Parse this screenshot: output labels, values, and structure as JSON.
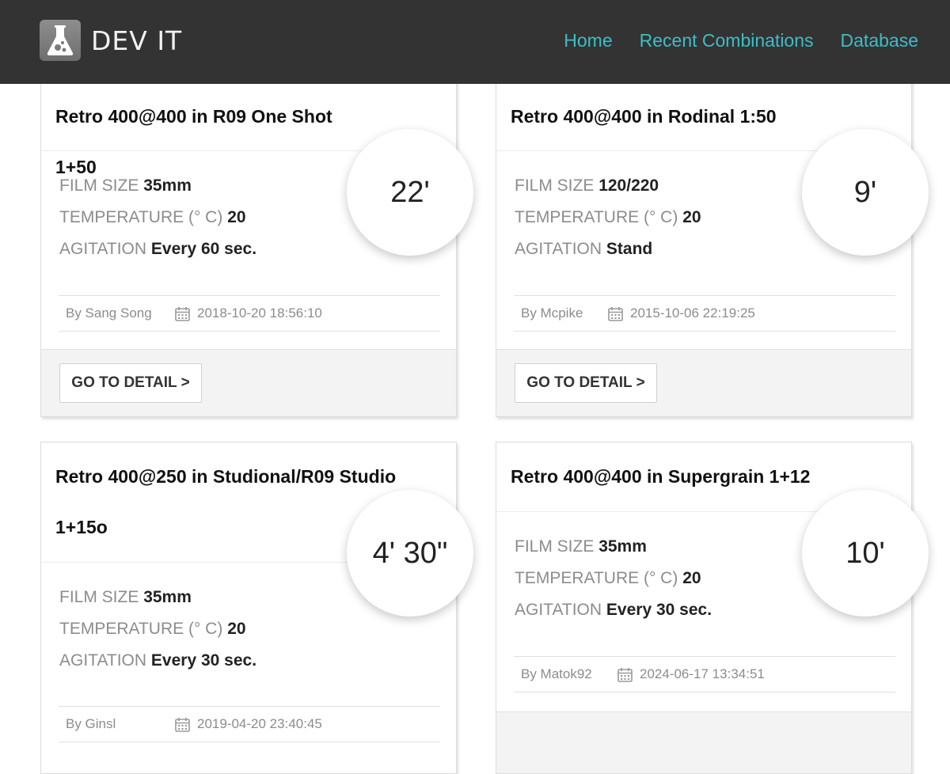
{
  "header": {
    "brand": "DEV IT",
    "nav": [
      "Home",
      "Recent Combinations",
      "Database"
    ]
  },
  "labels": {
    "film_size": "FILM SIZE",
    "temperature": "TEMPERATURE (° C)",
    "agitation": "AGITATION",
    "detail_button": "GO TO DETAIL >"
  },
  "cards": [
    {
      "title": "Retro 400@400 in R09 One Shot 1+50",
      "time": "22'",
      "film_size": "35mm",
      "temperature": "20",
      "agitation": "Every 60 sec.",
      "author": "By Sang Song",
      "date": "2018-10-20 18:56:10"
    },
    {
      "title": "Retro 400@400 in Rodinal 1:50",
      "time": "9'",
      "film_size": "120/220",
      "temperature": "20",
      "agitation": "Stand",
      "author": "By Mcpike",
      "date": "2015-10-06 22:19:25"
    },
    {
      "title": "Retro 400@250 in Studional/R09 Studio 1+15o",
      "time": "4' 30\"",
      "film_size": "35mm",
      "temperature": "20",
      "agitation": "Every 30 sec.",
      "author": "By Ginsl",
      "date": "2019-04-20 23:40:45"
    },
    {
      "title": "Retro 400@400 in Supergrain 1+12",
      "time": "10'",
      "film_size": "35mm",
      "temperature": "20",
      "agitation": "Every 30 sec.",
      "author": "By Matok92",
      "date": "2024-06-17 13:34:51"
    }
  ]
}
